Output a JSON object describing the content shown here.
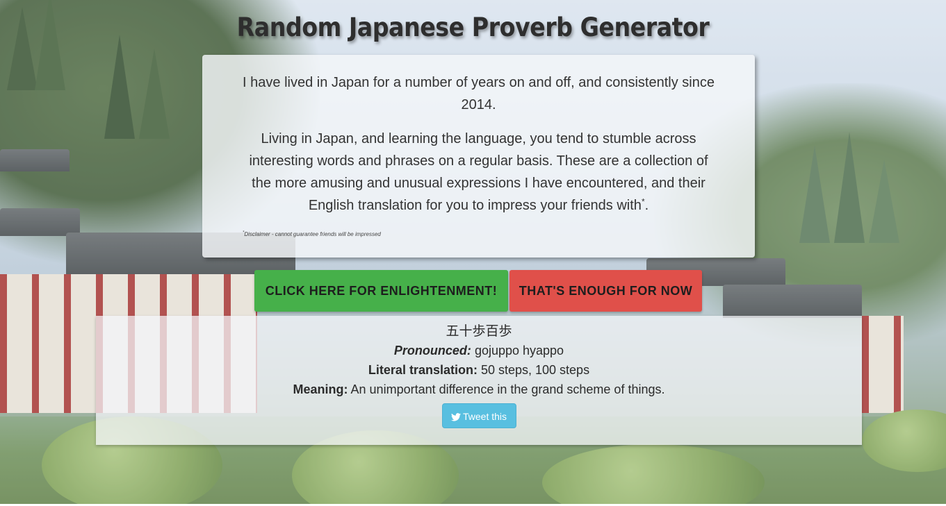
{
  "page": {
    "title": "Random Japanese Proverb Generator"
  },
  "intro": {
    "paragraph1": "I have lived in Japan for a number of years on and off, and consistently since 2014.",
    "paragraph2": "Living in Japan, and learning the language, you tend to stumble across interesting words and phrases on a regular basis. These are a collection of the more amusing and unusual expressions I have encountered, and their English translation for you to impress your friends with",
    "paragraph2_marker": "*",
    "paragraph2_end": ".",
    "disclaimer_marker": "*",
    "disclaimer": "Disclaimer - cannot guarantee friends will be impressed"
  },
  "buttons": {
    "enlighten_label": "CLICK HERE FOR ENLIGHTENMENT!",
    "stop_label": "THAT'S ENOUGH FOR NOW",
    "enlighten_color": "#46b04a",
    "stop_color": "#e0504a"
  },
  "proverb": {
    "japanese": "五十歩百歩",
    "pronounced_label": "Pronounced:",
    "pronounced_value": "gojuppo hyappo",
    "literal_label": "Literal translation:",
    "literal_value": "50 steps, 100 steps",
    "meaning_label": "Meaning:",
    "meaning_value": "An unimportant difference in the grand scheme of things."
  },
  "tweet": {
    "icon": "twitter-bird-icon",
    "label": "Tweet this",
    "color": "#58bfe0"
  }
}
